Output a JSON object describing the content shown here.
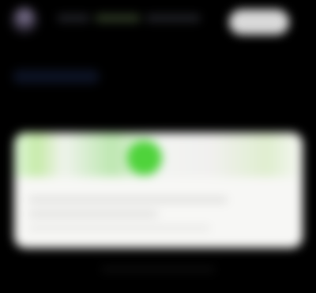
{
  "header": {},
  "main": {},
  "card": {}
}
